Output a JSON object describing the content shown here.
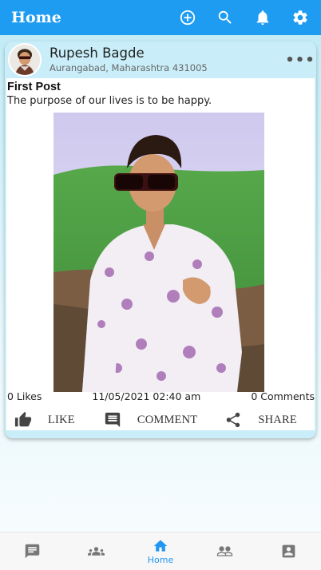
{
  "app": {
    "title": "Home"
  },
  "toolbar": {
    "icons": [
      "add-circle-icon",
      "search-icon",
      "notifications-icon",
      "settings-icon"
    ]
  },
  "post": {
    "author_name": "Rupesh Bagde",
    "author_location": "Aurangabad, Maharashtra 431005",
    "title": "First Post",
    "text": "The purpose of our lives is to be happy.",
    "likes_text": "0 Likes",
    "timestamp": "11/05/2021 02:40 am",
    "comments_text": "0 Comments",
    "actions": {
      "like": "LIKE",
      "comment": "COMMENT",
      "share": "SHARE"
    },
    "more_glyph": "•••"
  },
  "bottom_nav": {
    "items": [
      {
        "icon": "chat-icon"
      },
      {
        "icon": "groups-icon"
      },
      {
        "icon": "home-icon",
        "label": "Home",
        "active": true
      },
      {
        "icon": "people-icon"
      },
      {
        "icon": "account-box-icon"
      }
    ]
  },
  "colors": {
    "app_bar": "#1e9cf2",
    "card_background": "#c9eef9",
    "active_nav": "#2196f3"
  }
}
